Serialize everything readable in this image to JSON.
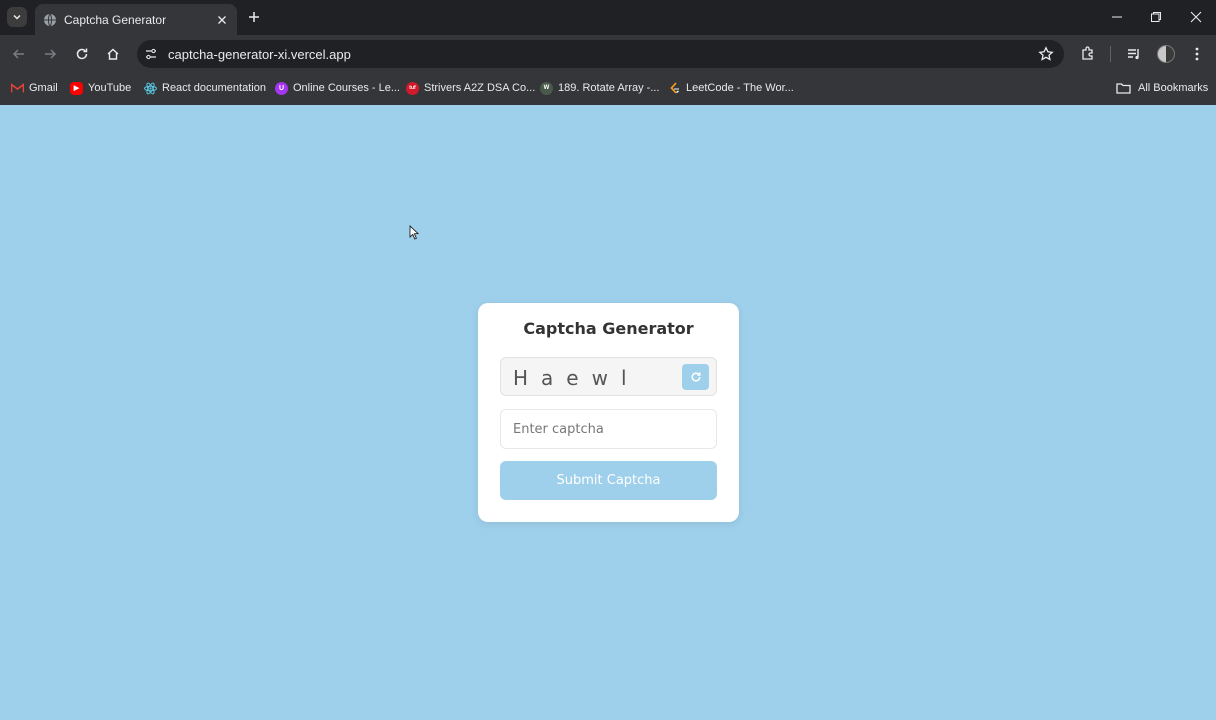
{
  "browser": {
    "tab_title": "Captcha Generator",
    "url": "captcha-generator-xi.vercel.app",
    "bookmarks": [
      {
        "label": "Gmail",
        "icon": "gmail-icon",
        "color": "#ea4335"
      },
      {
        "label": "YouTube",
        "icon": "youtube-icon",
        "color": "#ff0000"
      },
      {
        "label": "React documentation",
        "icon": "react-icon",
        "color": "#58c4dc"
      },
      {
        "label": "Online Courses - Le...",
        "icon": "udemy-icon",
        "color": "#a435f0"
      },
      {
        "label": "Strivers A2Z DSA Co...",
        "icon": "tuf-icon",
        "color": "#d11a2a"
      },
      {
        "label": "189. Rotate Array -...",
        "icon": "w3-icon",
        "color": "#4a5a4a"
      },
      {
        "label": "LeetCode - The Wor...",
        "icon": "leetcode-icon",
        "color": "#ffa116"
      }
    ],
    "all_bookmarks_label": "All Bookmarks"
  },
  "page": {
    "title": "Captcha Generator",
    "captcha_text": "Haewl",
    "input_placeholder": "Enter captcha",
    "input_value": "",
    "submit_label": "Submit Captcha",
    "colors": {
      "background": "#9ecfeb",
      "card": "#ffffff",
      "accent": "#9ecfeb"
    }
  }
}
